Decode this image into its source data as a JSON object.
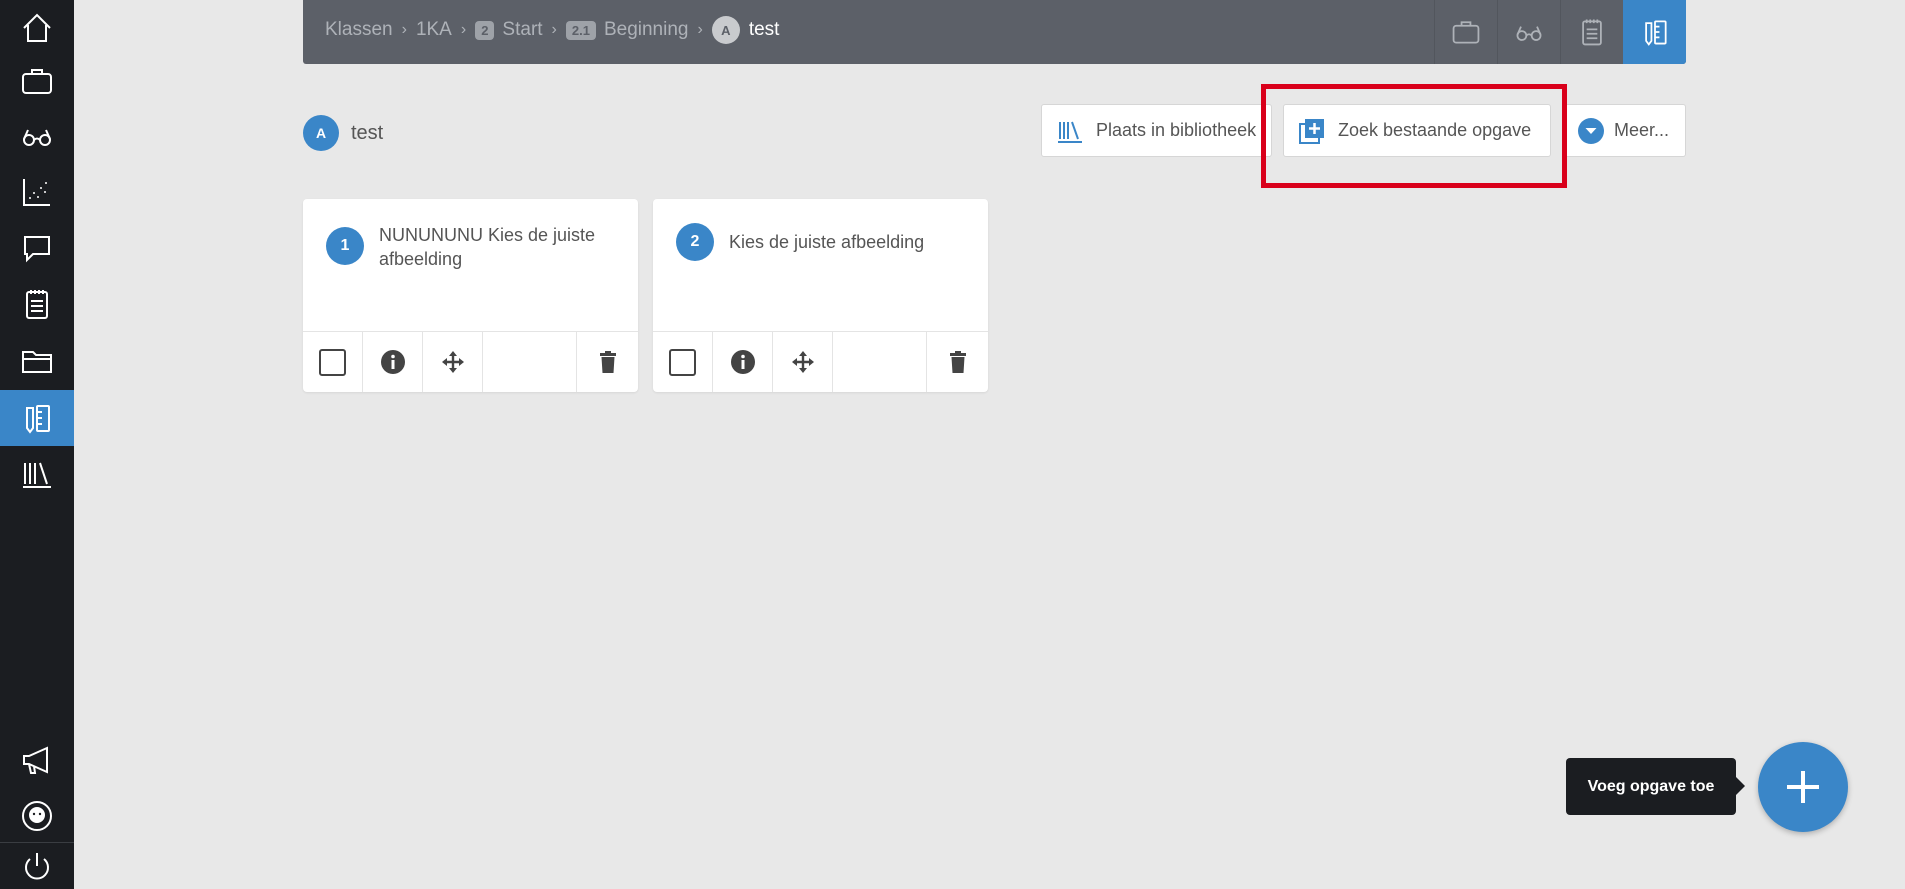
{
  "sidebar": {
    "items": [
      {
        "icon": "home-icon"
      },
      {
        "icon": "briefcase-icon"
      },
      {
        "icon": "glasses-icon"
      },
      {
        "icon": "scatter-chart-icon"
      },
      {
        "icon": "chat-bubble-icon"
      },
      {
        "icon": "clipboard-icon"
      },
      {
        "icon": "folder-icon"
      },
      {
        "icon": "exercise-pencil-icon",
        "active": true
      },
      {
        "icon": "library-icon"
      }
    ],
    "bottom_items": [
      {
        "icon": "megaphone-icon"
      },
      {
        "icon": "user-avatar-icon"
      },
      {
        "icon": "power-icon"
      }
    ]
  },
  "breadcrumb": {
    "items": [
      {
        "label": "Klassen"
      },
      {
        "label": "1KA"
      },
      {
        "badge": "2",
        "label": "Start"
      },
      {
        "badge": "2.1",
        "label": "Beginning"
      },
      {
        "circle": "A",
        "label": "test"
      }
    ]
  },
  "top_tools": [
    "briefcase-icon",
    "glasses-icon",
    "clipboard-icon",
    "exercise-pencil-icon"
  ],
  "page": {
    "avatar_letter": "A",
    "title": "test"
  },
  "actions": {
    "place_in_library": "Plaats in bibliotheek",
    "search_existing": "Zoek bestaande opgave",
    "more": "Meer..."
  },
  "cards": [
    {
      "number": "1",
      "text": "NUNUNUNU Kies de juiste afbeelding"
    },
    {
      "number": "2",
      "text": "Kies de juiste afbeelding"
    }
  ],
  "tooltip": {
    "text": "Voeg opgave toe"
  },
  "colors": {
    "accent": "#3a86c8",
    "sidebar": "#1b1d21",
    "topbar": "#5c6068",
    "background": "#e8e8e8",
    "highlight": "#d9001b"
  }
}
